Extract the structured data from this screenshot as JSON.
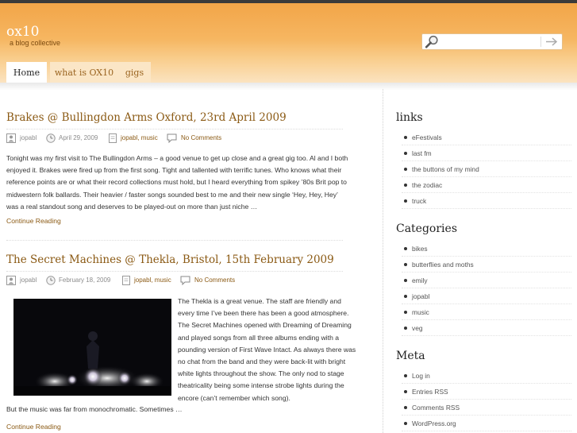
{
  "site": {
    "title": "ox10",
    "tagline": "a blog collective"
  },
  "search": {
    "placeholder": "",
    "value": ""
  },
  "nav": {
    "tabs": [
      {
        "label": "Home"
      },
      {
        "label": "what is OX10"
      },
      {
        "label": "gigs"
      }
    ],
    "active": "Home"
  },
  "posts": [
    {
      "title": "Brakes @ Bullingdon Arms Oxford, 23rd April 2009",
      "author": "jopabl",
      "date": "April 29, 2009",
      "category": "jopabl, music",
      "comments": "No Comments",
      "lines": [
        "Tonight was my first visit to The Bullingdon Arms – a good venue to get up close and a great gig too. Al and I both",
        "enjoyed it. Brakes were fired up from the first song. Tight and tallented with terrific tunes. Who knows what their",
        "reference points are or what their record collections must hold, but I heard everything from spikey ’80s Brit pop to",
        "midwestern folk ballards. Their heavier / faster songs sounded best to me and their new single ‘Hey, Hey, Hey’",
        "was a real standout song and deserves to be played-out on more than just niche …"
      ],
      "more": "Continue Reading"
    },
    {
      "title": "The Secret Machines @ Thekla, Bristol, 15th February 2009",
      "author": "jopabl",
      "date": "February 18, 2009",
      "category": "jopabl, music",
      "comments": "No Comments",
      "lines": [
        "The Thekla is a great venue. The staff are friendly and",
        "every time I’ve been there has been a good atmosphere.",
        "The Secret Machines opened with Dreaming of Dreaming",
        "and played songs from all three albums ending with a",
        "pounding version of First Wave Intact. As always there was",
        "no chat from the band and they were back-lit with bright",
        "white lights throughout the show. The only nod to stage",
        "theatricality being some intense strobe lights during the",
        "encore (can’t remember which song)."
      ],
      "after": "But the music was far from monochromatic. Sometimes …",
      "more": "Continue Reading"
    }
  ],
  "sidebar": {
    "links": {
      "heading": "links",
      "items": [
        "eFestivals",
        "last fm",
        "the buttons of my mind",
        "the zodiac",
        "truck"
      ]
    },
    "categories": {
      "heading": "Categories",
      "items": [
        "bikes",
        "butterflies and moths",
        "emily",
        "jopabl",
        "music",
        "veg"
      ]
    },
    "meta": {
      "heading": "Meta",
      "items": [
        "Log in",
        "Entries RSS",
        "Comments RSS",
        "WordPress.org"
      ]
    }
  },
  "colors": {
    "accent": "#f6b661",
    "link": "#8b5a14",
    "header_dark": "#f2a548"
  }
}
